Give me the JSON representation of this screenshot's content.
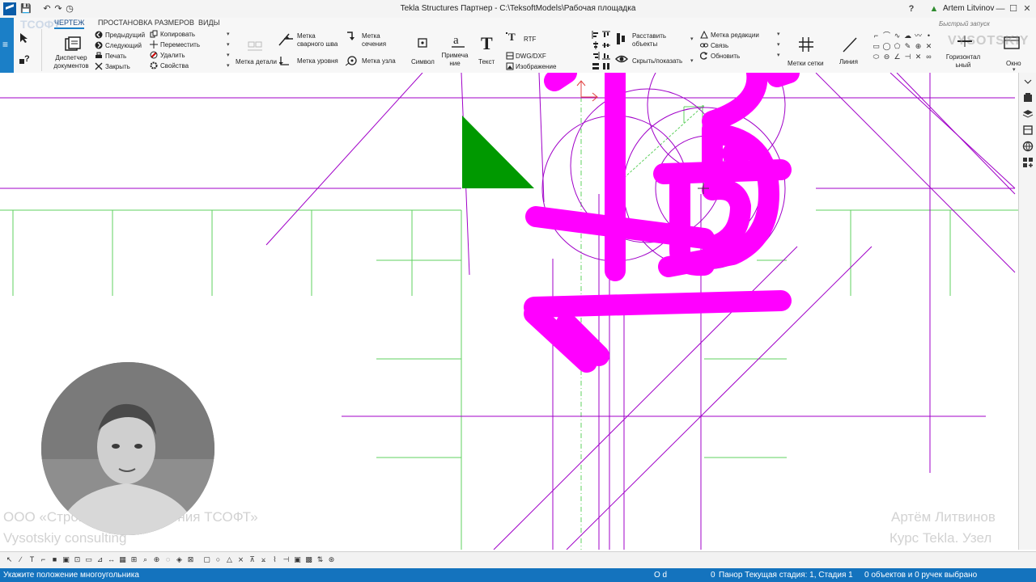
{
  "window": {
    "title": "Tekla Structures Партнер - C:\\TeksoftModels\\Рабочая площадка",
    "user": "Artem Litvinov",
    "search_placeholder": "Быстрый запуск",
    "help_label": "?",
    "minimize": "—",
    "maximize": "☐",
    "close": "✕"
  },
  "ribbon": {
    "tabs": [
      {
        "label": "ЧЕРТЕЖ",
        "active": true
      },
      {
        "label": "ПРОСТАНОВКА РАЗМЕРОВ",
        "active": false
      },
      {
        "label": "ВИДЫ",
        "active": false
      }
    ],
    "doc_manager": "Диспетчер\nдокументов",
    "nav": {
      "prev": "Предыдущий",
      "next": "Следующий",
      "print": "Печать",
      "close": "Закрыть"
    },
    "edit": {
      "copy": "Копировать",
      "move": "Переместить",
      "delete": "Удалить",
      "properties": "Свойства"
    },
    "part_mark": "Метка детали",
    "weld_mark": "Метка\nсварного шва",
    "level_mark": "Метка уровня",
    "section_mark": "Метка\nсечения",
    "node_mark": "Метка узла",
    "symbol": "Символ",
    "note": "Примеча\nние",
    "text": "Текст",
    "rtf": "RTF",
    "dwg": "DWG/DXF",
    "image": "Изображение",
    "arrange": "Расставить\nобъекты",
    "hide_show": "Скрыть/показать",
    "edit_mark": "Метка редакции",
    "link": "Связь",
    "update": "Обновить",
    "grid_marks": "Метки сетки",
    "line": "Линия",
    "horizontal": "Горизонтал\nьный",
    "window": "Окно"
  },
  "watermarks": {
    "company": "ООО «Строительные решения ТСОФТ»",
    "consulting": "Vysotskiy consulting",
    "author": "Артём Литвинов",
    "course": "Курс Tekla. Узел",
    "logo_left": "TCOФТ",
    "logo_right": "VYSOTSKIY"
  },
  "statusbar": {
    "prompt": "Укажите положение многоугольника",
    "mode": "O d",
    "zero": "0",
    "stage": "Панор Текущая стадия: 1, Стадия 1",
    "selection": "0 объектов и 0 ручек выбрано"
  },
  "colors": {
    "accent": "#1b7fc7",
    "status": "#1473be",
    "magenta": "#ff00ff",
    "line_purple": "#a000c8",
    "grid_green": "#5fd05f",
    "fill_green": "#009900"
  }
}
